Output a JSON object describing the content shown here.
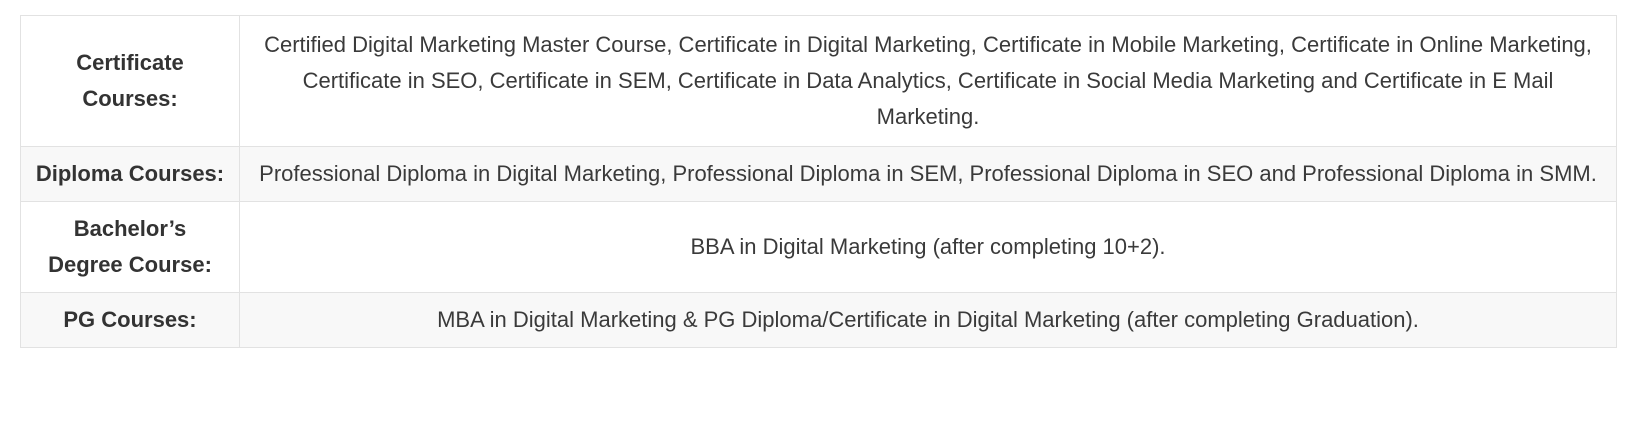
{
  "table": {
    "rows": [
      {
        "label": "Certificate Courses:",
        "value": "Certified Digital Marketing Master Course, Certificate in Digital Marketing, Certificate in Mobile Marketing, Certificate in Online Marketing, Certificate in SEO, Certificate in SEM, Certificate in Data Analytics, Certificate in Social Media Marketing and Certificate in E Mail Marketing."
      },
      {
        "label": "Diploma Courses:",
        "value": "Professional Diploma in Digital Marketing, Professional Diploma in SEM, Professional Diploma in SEO and Professional Diploma in SMM."
      },
      {
        "label": "Bachelor’s Degree Course:",
        "value": "BBA in Digital Marketing (after completing 10+2)."
      },
      {
        "label": "PG Courses:",
        "value": "MBA in Digital Marketing & PG Diploma/Certificate in Digital Marketing (after completing Graduation)."
      }
    ]
  }
}
